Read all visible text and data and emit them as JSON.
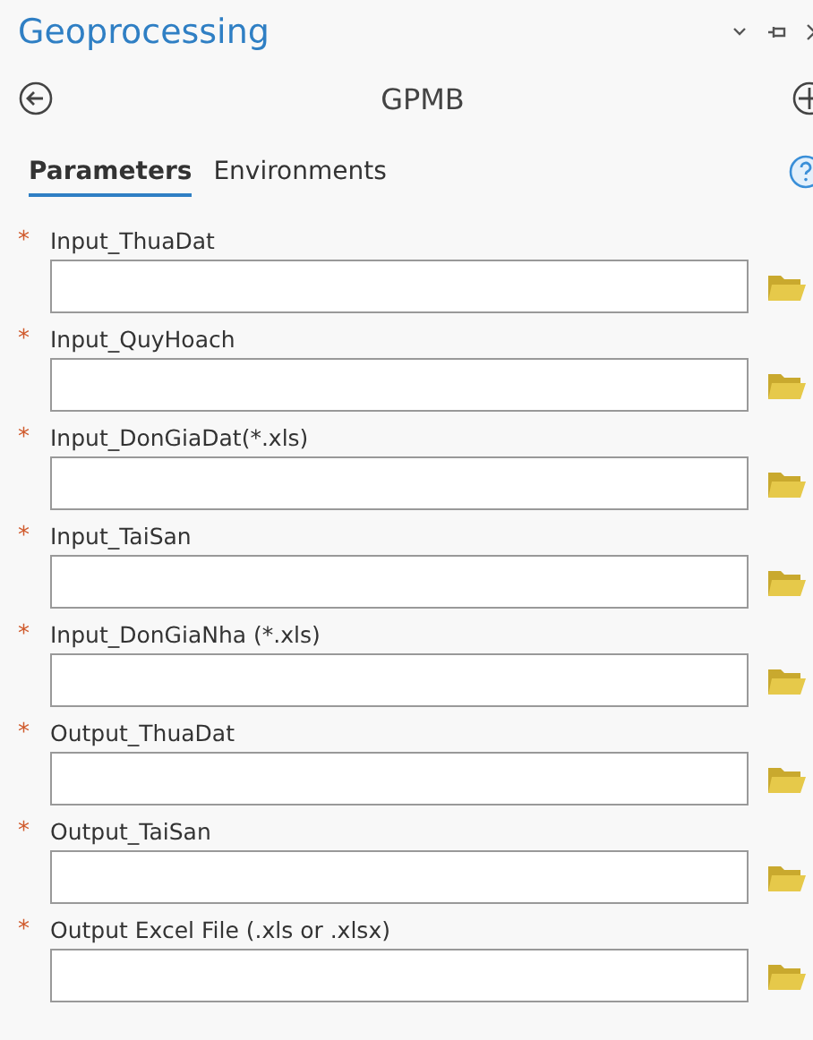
{
  "window": {
    "title": "Geoprocessing"
  },
  "tool": {
    "name": "GPMB"
  },
  "tabs": [
    {
      "label": "Parameters",
      "selected": true
    },
    {
      "label": "Environments",
      "selected": false
    }
  ],
  "parameters": [
    {
      "mark": "*",
      "label": "Input_ThuaDat"
    },
    {
      "mark": "*",
      "label": "Input_QuyHoach"
    },
    {
      "mark": "*",
      "label": "Input_DonGiaDat(*.xls)"
    },
    {
      "mark": "*",
      "label": "Input_TaiSan"
    },
    {
      "mark": "*",
      "label": "Input_DonGiaNha (*.xls)"
    },
    {
      "mark": "*",
      "label": "Output_ThuaDat"
    },
    {
      "mark": "*",
      "label": "Output_TaiSan"
    },
    {
      "mark": "*",
      "label": "Output Excel File (.xls or .xlsx)"
    }
  ]
}
